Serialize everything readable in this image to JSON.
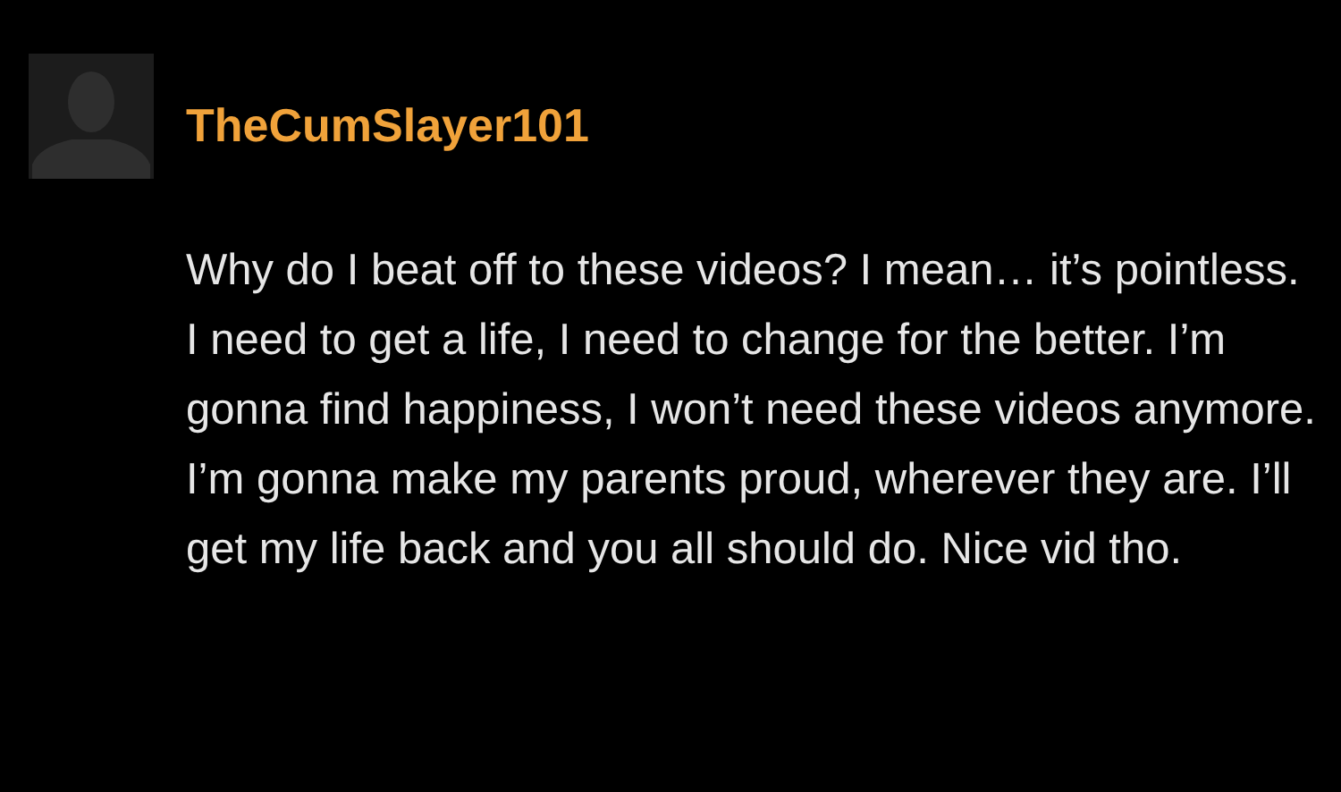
{
  "comment": {
    "username": "TheCumSlayer101",
    "text": "Why do I beat off to these videos? I mean… it’s pointless. I need to get a life, I need to change for the better. I’m gonna find happiness, I won’t need these videos anymore. I’m gonna make my parents proud, wherever they are. I’ll get my life back and you all should do. Nice vid tho."
  }
}
